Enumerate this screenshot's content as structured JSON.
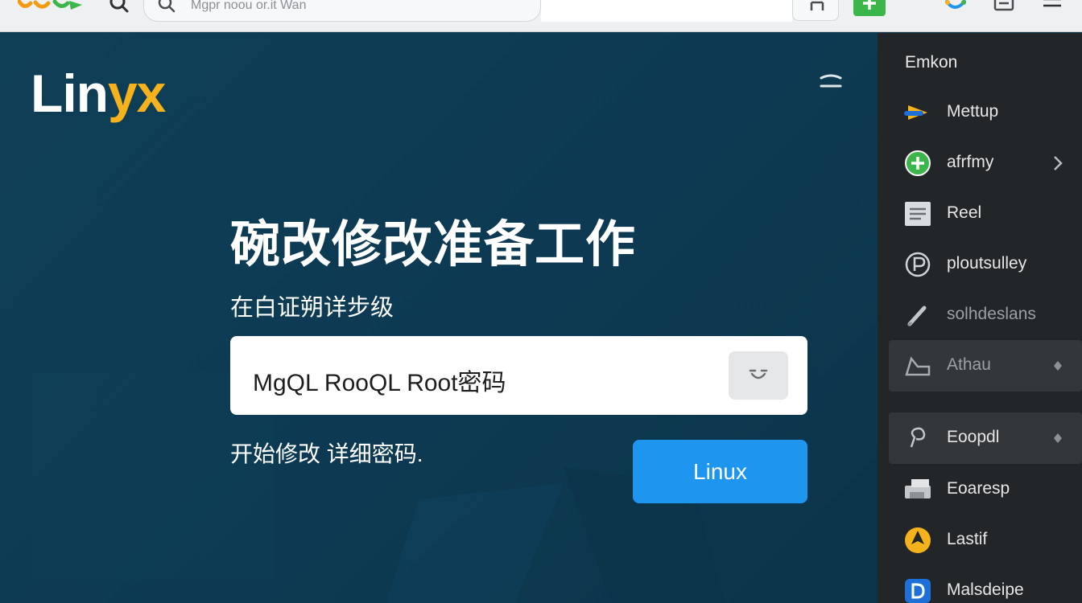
{
  "toolbar": {
    "address_text": "Mgpr noou or.it Wan"
  },
  "brand": {
    "part_white": "Lin",
    "part_accent": "yx"
  },
  "main": {
    "title": "碗改修改准备工作",
    "subtitle": "在白证朔详步级",
    "field_value": "MgQL RooQL Root密码",
    "hint": "开始修改 详细密码.",
    "primary_button": "Linux"
  },
  "sidebar": {
    "title": "Emkon",
    "items": [
      {
        "label": "Mettup",
        "icon": "arrow-logo-icon"
      },
      {
        "label": "afrfmy",
        "icon": "plus-circle-icon",
        "trailing": "chevron-right-icon"
      },
      {
        "label": "Reel",
        "icon": "document-icon"
      },
      {
        "label": "ploutsulley",
        "icon": "p-circle-icon"
      },
      {
        "label": "solhdeslans",
        "icon": "pen-icon"
      },
      {
        "label": "Athau",
        "icon": "folder-icon",
        "trailing": "diamond-icon"
      },
      {
        "label": "Eoopdl",
        "icon": "loop-icon",
        "trailing": "diamond-icon"
      },
      {
        "label": "Eoaresp",
        "icon": "printer-icon"
      },
      {
        "label": "Lastif",
        "icon": "yellow-circle-icon"
      },
      {
        "label": "Malsdeipe",
        "icon": "blue-d-icon"
      }
    ]
  },
  "colors": {
    "main_bg": "#0e3a52",
    "brand_accent": "#f5b21c",
    "primary_button": "#1e96f0",
    "sidebar_bg": "#232628",
    "green": "#3cb54a"
  }
}
